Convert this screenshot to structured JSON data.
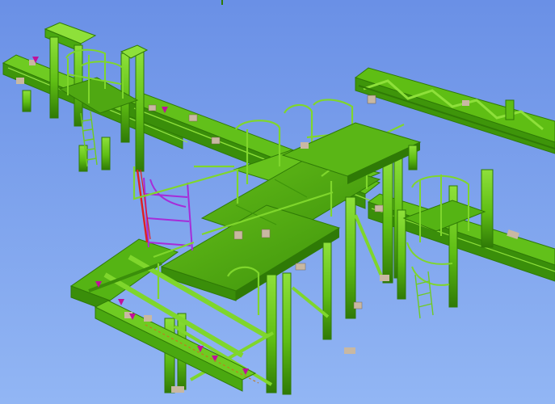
{
  "viewport": {
    "kind": "3d-cad-model-view",
    "background_top": "#6a90e6",
    "background_bottom": "#92b6f4"
  },
  "model": {
    "subject": "steel-structure-with-platforms-handrails-and-ladders",
    "colors": {
      "steel": "#5fbe14",
      "steel_light": "#8ee03a",
      "steel_dark": "#2f7a06",
      "deck": "#4fa812",
      "connection_plate": "#c8b8a2",
      "selection_highlight": "#a62cd8",
      "selection_red": "#e02020",
      "marker": "#c0109a"
    }
  }
}
